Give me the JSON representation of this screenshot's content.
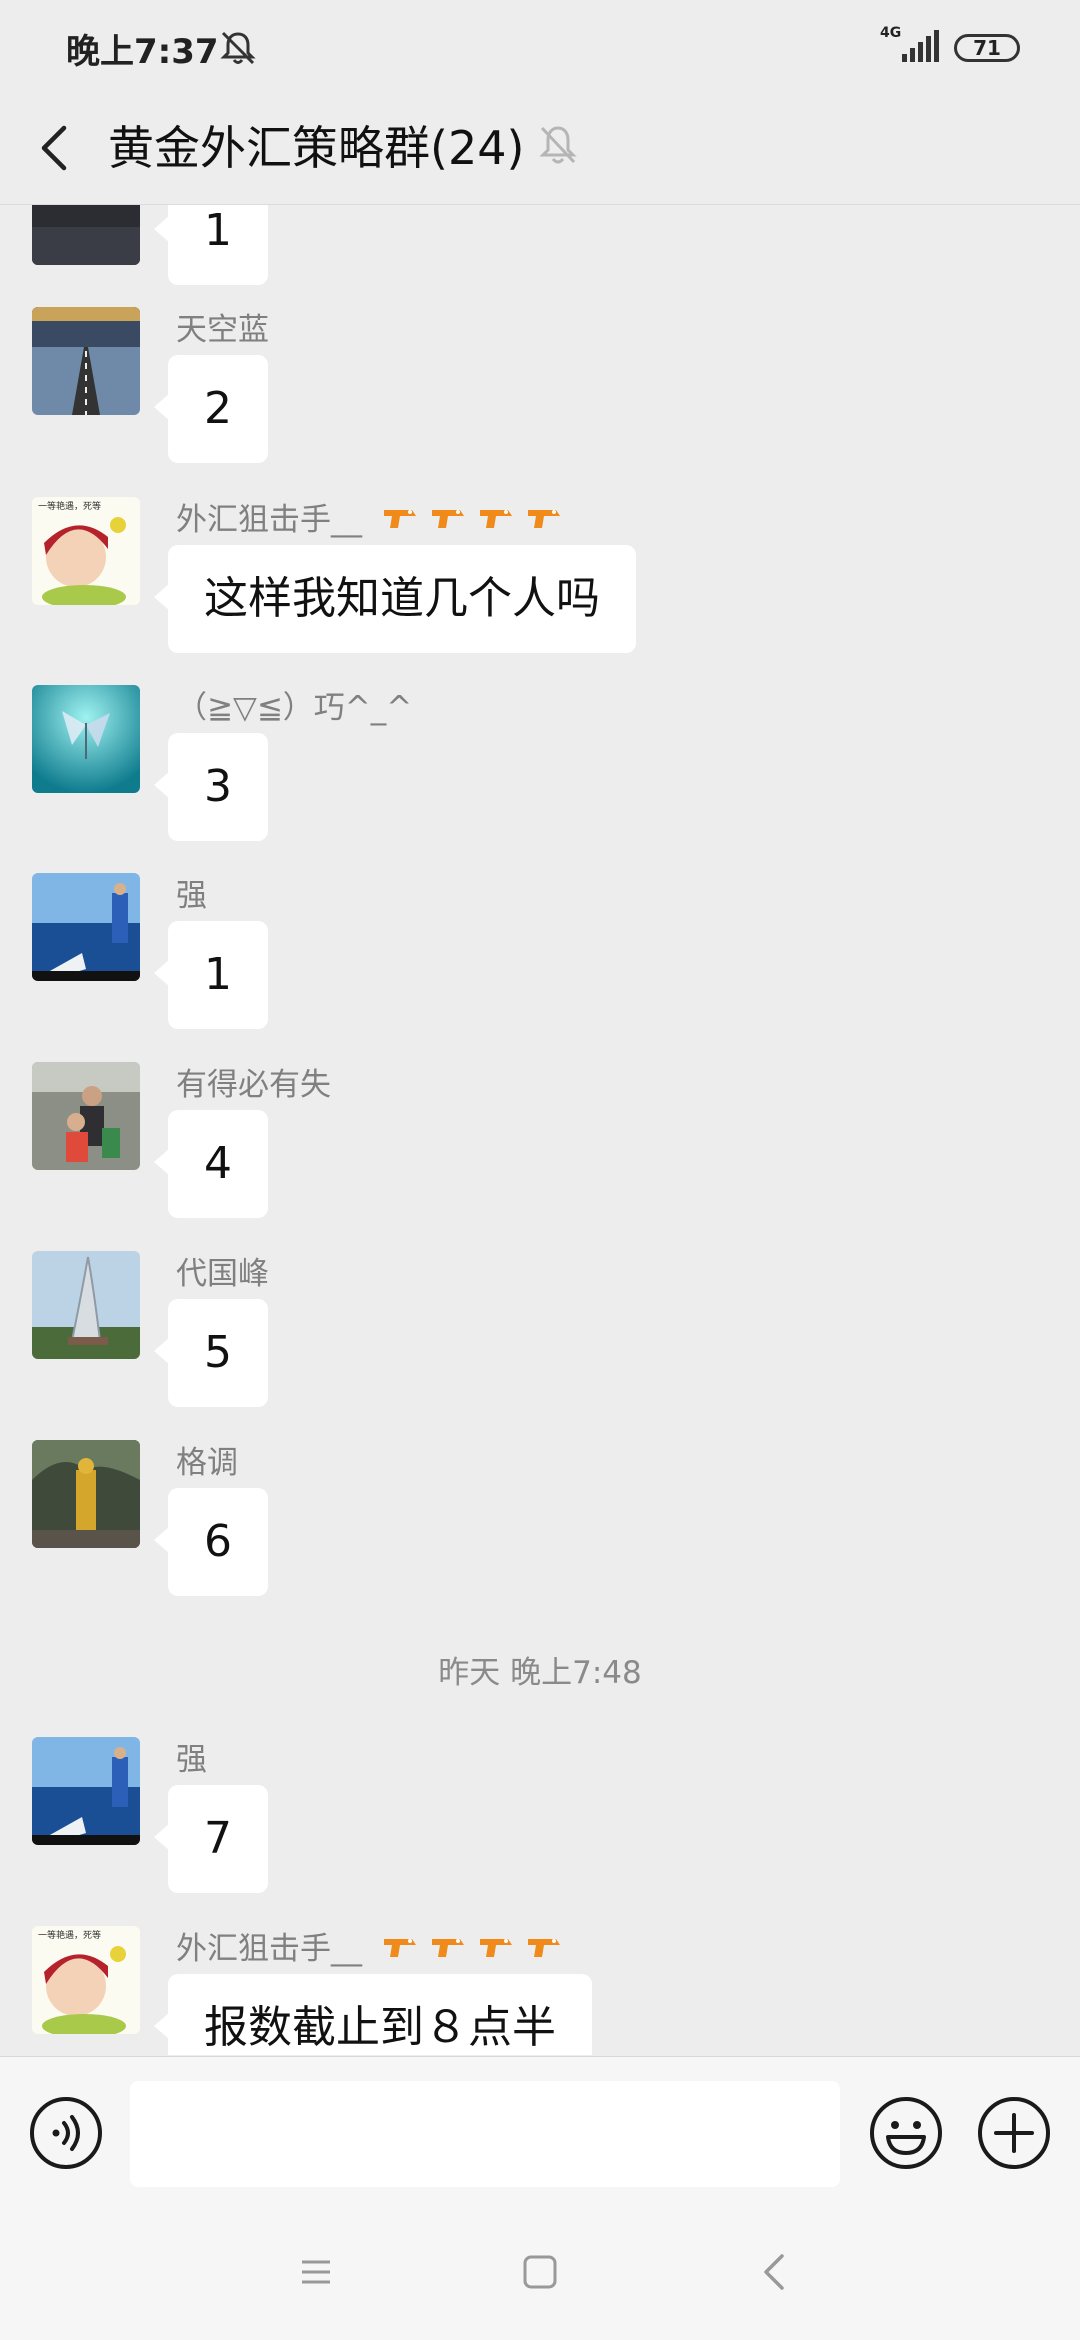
{
  "status_bar": {
    "time": "晚上7:37",
    "network": "4G",
    "battery": "71"
  },
  "header": {
    "title": "黄金外汇策略群(24)"
  },
  "messages": [
    {
      "sender": "",
      "text": "1",
      "avatar": "dark-avatar"
    },
    {
      "sender": "天空蓝",
      "text": "2",
      "avatar": "road-avatar"
    },
    {
      "sender": "外汇狙击手__",
      "text": "这样我知道几个人吗",
      "avatar": "cartoon-girl-avatar",
      "avatar_text": "一等艳遇，死等"
    },
    {
      "sender": "（≧▽≦）巧^_^",
      "text": "3",
      "avatar": "butterfly-avatar"
    },
    {
      "sender": "强",
      "text": "1",
      "avatar": "sea-avatar"
    },
    {
      "sender": "有得必有失",
      "text": "4",
      "avatar": "family-avatar"
    },
    {
      "sender": "代国峰",
      "text": "5",
      "avatar": "sculpture-avatar"
    },
    {
      "sender": "格调",
      "text": "6",
      "avatar": "golden-statue-avatar"
    },
    {
      "sender": "强",
      "text": "7",
      "avatar": "sea-avatar"
    },
    {
      "sender": "外汇狙击手__",
      "text": "报数截止到８点半",
      "avatar": "cartoon-girl-avatar",
      "avatar_text": "一等艳遇，死等"
    }
  ],
  "timestamp": "昨天 晚上7:48",
  "input": {
    "placeholder": ""
  },
  "colors": {
    "background": "#ededed",
    "bubble": "#ffffff",
    "sender": "#808080"
  }
}
